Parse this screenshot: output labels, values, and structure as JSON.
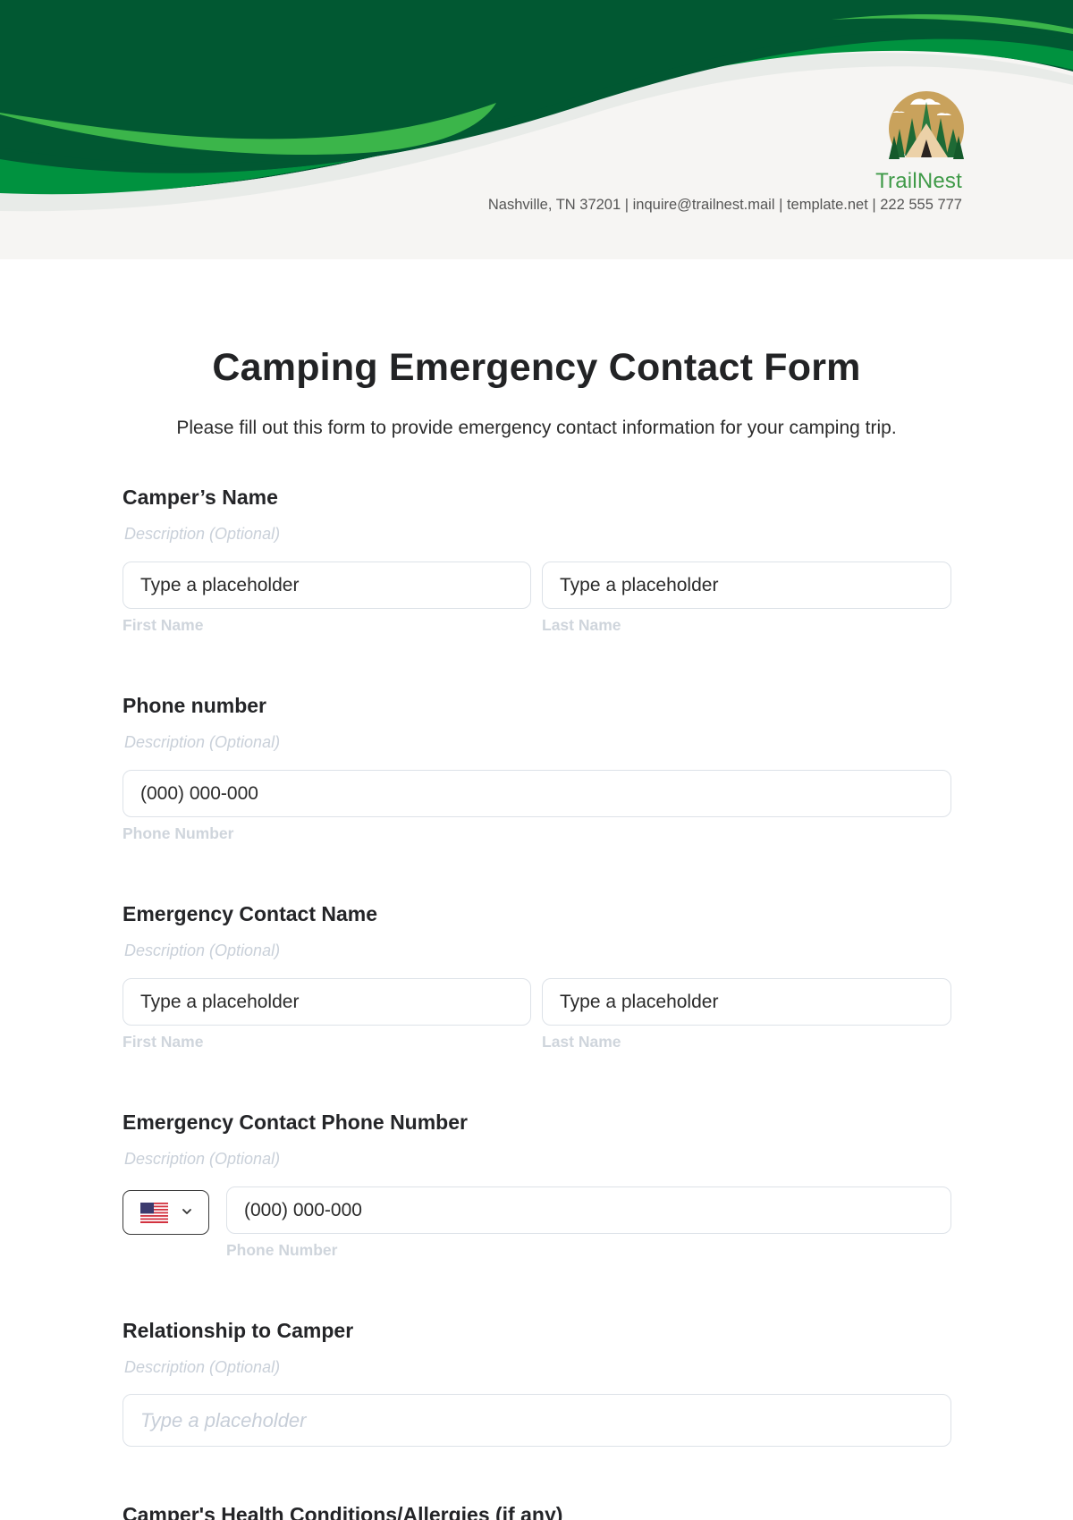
{
  "header": {
    "brand_name": "TrailNest",
    "contact_line": "Nashville, TN 37201 | inquire@trailnest.mail | template.net | 222 555 777",
    "logo_icon": "campsite-tent-trees-logo",
    "colors": {
      "dark_green": "#015832",
      "mid_green": "#00923f",
      "light_green": "#3bb54a",
      "band_gray": "#e8ebe8",
      "background": "#f6f5f3",
      "brand_text": "#3f9a48",
      "logo_sun": "#c9a25c"
    }
  },
  "form": {
    "title": "Camping Emergency Contact Form",
    "subtitle": "Please fill out this form to provide emergency contact information for your camping trip.",
    "fields": [
      {
        "label": "Camper’s Name",
        "description": "Description (Optional)",
        "inputs": [
          {
            "value": "Type a placeholder",
            "sublabel": "First Name"
          },
          {
            "value": "Type a placeholder",
            "sublabel": "Last Name"
          }
        ]
      },
      {
        "label": "Phone number",
        "description": "Description (Optional)",
        "inputs": [
          {
            "value": "(000) 000-000",
            "sublabel": "Phone Number"
          }
        ]
      },
      {
        "label": "Emergency Contact Name",
        "description": "Description (Optional)",
        "inputs": [
          {
            "value": "Type a placeholder",
            "sublabel": "First Name"
          },
          {
            "value": "Type a placeholder",
            "sublabel": "Last Name"
          }
        ]
      },
      {
        "label": "Emergency Contact Phone Number",
        "description": "Description (Optional)",
        "country_selector": {
          "selected": "US",
          "icon": "us-flag-icon"
        },
        "inputs": [
          {
            "value": "(000) 000-000",
            "sublabel": "Phone Number"
          }
        ]
      },
      {
        "label": "Relationship to Camper",
        "description": "Description (Optional)",
        "inputs": [
          {
            "placeholder": "Type a placeholder"
          }
        ]
      },
      {
        "label": "Camper's Health Conditions/Allergies (if any)"
      }
    ]
  }
}
